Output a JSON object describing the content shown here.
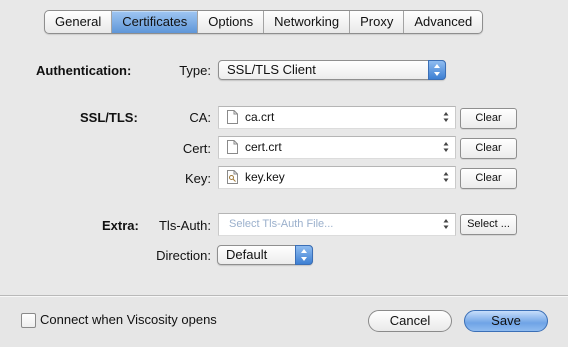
{
  "tabs": [
    "General",
    "Certificates",
    "Options",
    "Networking",
    "Proxy",
    "Advanced"
  ],
  "active_tab": "Certificates",
  "authentication": {
    "section_label": "Authentication:",
    "type_label": "Type:",
    "type_value": "SSL/TLS Client"
  },
  "ssl_tls": {
    "section_label": "SSL/TLS:",
    "ca": {
      "label": "CA:",
      "file": "ca.crt",
      "button": "Clear"
    },
    "cert": {
      "label": "Cert:",
      "file": "cert.crt",
      "button": "Clear"
    },
    "key": {
      "label": "Key:",
      "file": "key.key",
      "button": "Clear"
    }
  },
  "extra": {
    "section_label": "Extra:",
    "tls_auth_label": "Tls-Auth:",
    "tls_auth_placeholder": "Select Tls-Auth File...",
    "select_button": "Select ...",
    "direction_label": "Direction:",
    "direction_value": "Default"
  },
  "footer": {
    "connect_label": "Connect when Viscosity opens",
    "connect_checked": false,
    "cancel": "Cancel",
    "save": "Save"
  }
}
